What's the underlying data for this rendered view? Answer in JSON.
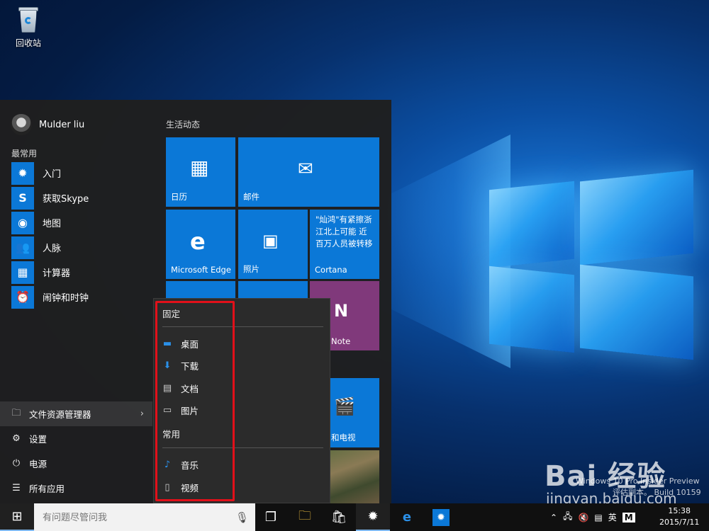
{
  "desktop": {
    "recycle_bin_label": "回收站",
    "build_line1": "Windows 10 Pro Insider Preview",
    "build_line2": "评估副本。 Build 10159",
    "watermark_logo": "Bai 经验",
    "watermark_site": "jingyan.baidu.com"
  },
  "start_menu": {
    "user_name": "Mulder liu",
    "most_used_title": "最常用",
    "apps": [
      {
        "label": "入门",
        "icon": "lightbulb-icon"
      },
      {
        "label": "获取Skype",
        "icon": "skype-icon"
      },
      {
        "label": "地图",
        "icon": "map-pin-icon"
      },
      {
        "label": "人脉",
        "icon": "people-icon"
      },
      {
        "label": "计算器",
        "icon": "calculator-icon"
      },
      {
        "label": "闹钟和时钟",
        "icon": "alarm-clock-icon"
      }
    ],
    "bottom": {
      "file_explorer": "文件资源管理器",
      "settings": "设置",
      "power": "电源",
      "all_apps": "所有应用"
    },
    "tiles_title": "生活动态",
    "tiles": {
      "calendar": "日历",
      "mail": "邮件",
      "edge": "Microsoft Edge",
      "photos": "照片",
      "cortana": "Cortana",
      "cortana_news": "\"灿鸿\"有紧擦浙江北上可能 近百万人员被转移",
      "onenote": "Note",
      "movies": "和电视"
    }
  },
  "context_menu": {
    "pinned_title": "固定",
    "pinned": [
      {
        "label": "桌面",
        "icon": "desktop-folder-icon"
      },
      {
        "label": "下载",
        "icon": "download-icon"
      },
      {
        "label": "文档",
        "icon": "document-icon"
      },
      {
        "label": "图片",
        "icon": "pictures-icon"
      }
    ],
    "frequent_title": "常用",
    "frequent": [
      {
        "label": "音乐",
        "icon": "music-icon"
      },
      {
        "label": "视频",
        "icon": "video-icon"
      }
    ]
  },
  "taskbar": {
    "search_placeholder": "有问题尽管问我",
    "ime_label": "英",
    "ime_mode": "M",
    "time": "15:38",
    "date": "2015/7/11"
  },
  "colors": {
    "accent": "#0b78d7",
    "onenote": "#80397b",
    "highlight_box": "#e2101a"
  }
}
